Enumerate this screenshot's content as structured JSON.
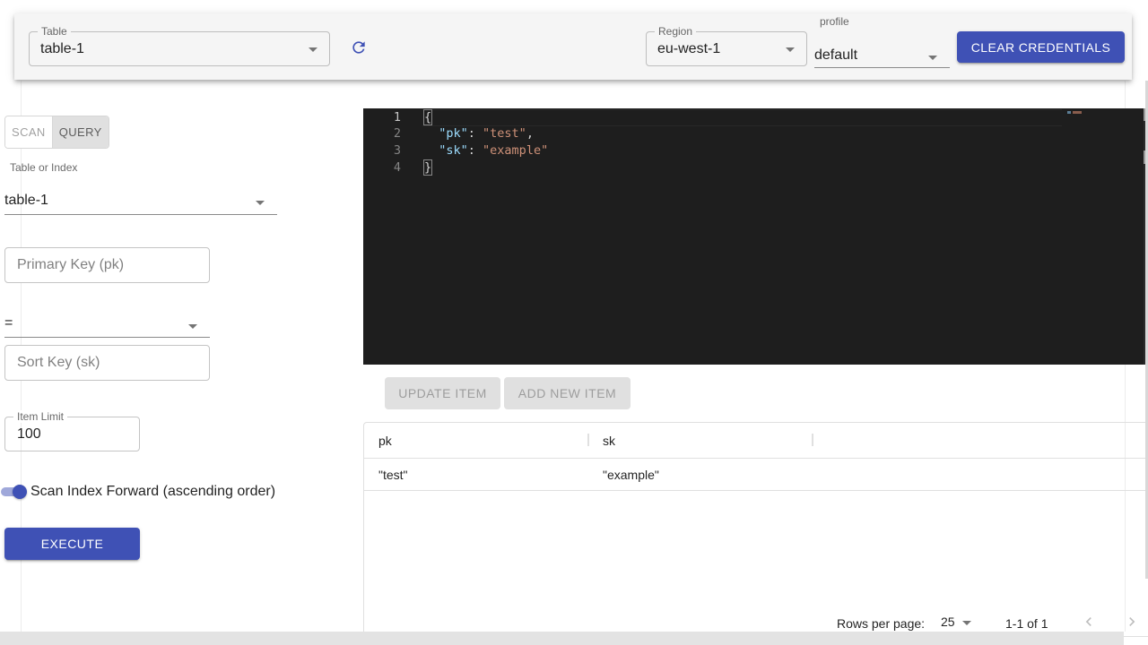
{
  "topbar": {
    "table_label": "Table",
    "table_value": "table-1",
    "refresh_icon": "refresh-icon",
    "region_label": "Region",
    "region_value": "eu-west-1",
    "profile_label": "profile",
    "profile_value": "default",
    "clear_credentials_label": "CLEAR CREDENTIALS"
  },
  "query_panel": {
    "mode_tabs": [
      {
        "label": "SCAN",
        "selected": false
      },
      {
        "label": "QUERY",
        "selected": true
      }
    ],
    "table_or_index_label": "Table or Index",
    "table_or_index_value": "table-1",
    "primary_key_placeholder": "Primary Key (pk)",
    "primary_key_value": "",
    "operator_value": "=",
    "sort_key_placeholder": "Sort Key (sk)",
    "sort_key_value": "",
    "item_limit_label": "Item Limit",
    "item_limit_value": "100",
    "scan_index_forward_label": "Scan Index Forward (ascending order)",
    "scan_index_forward_on": true,
    "execute_label": "EXECUTE"
  },
  "editor": {
    "lines": [
      {
        "number": "1",
        "text": "{"
      },
      {
        "number": "2",
        "key": "\"pk\"",
        "value": "\"test\"",
        "trail": ","
      },
      {
        "number": "3",
        "key": "\"sk\"",
        "value": "\"example\"",
        "trail": ""
      },
      {
        "number": "4",
        "text": "}"
      }
    ]
  },
  "actions": {
    "update_item_label": "UPDATE ITEM",
    "add_new_item_label": "ADD NEW ITEM"
  },
  "results_table": {
    "columns": [
      "pk",
      "sk"
    ],
    "rows": [
      [
        "\"test\"",
        "\"example\""
      ]
    ],
    "rows_per_page_label": "Rows per page:",
    "rows_per_page_value": "25",
    "page_info": "1-1 of 1"
  },
  "colors": {
    "primary": "#3f51b5",
    "editor_bg": "#1e1e1e",
    "json_key": "#9cdcfe",
    "json_string": "#ce9178"
  }
}
